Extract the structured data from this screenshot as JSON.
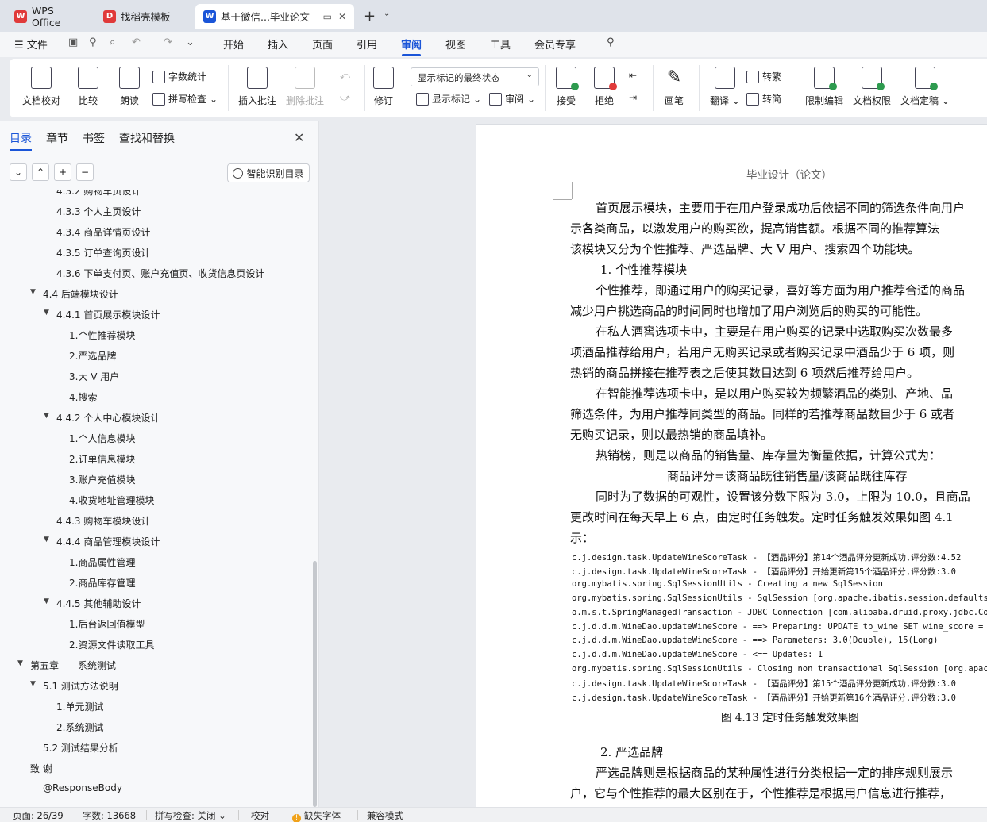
{
  "tabs": [
    {
      "label": "WPS Office",
      "logo": "wps-logo",
      "color": "#e03a3a"
    },
    {
      "label": "找稻壳模板",
      "logo": "daoke-logo",
      "color": "#e03a3a"
    },
    {
      "label": "基于微信...毕业论文",
      "logo": "writer-logo",
      "color": "#1a55d8"
    }
  ],
  "menu": {
    "file": "文件",
    "items": [
      "开始",
      "插入",
      "页面",
      "引用",
      "审阅",
      "视图",
      "工具",
      "会员专享"
    ],
    "active": "审阅"
  },
  "ribbon": {
    "proofread": "文档校对",
    "compare": "比较",
    "read_aloud": "朗读",
    "word_count": "字数统计",
    "spell_check": "拼写检查",
    "insert_comment": "插入批注",
    "delete_comment": "删除批注",
    "track_changes": "修订",
    "markup_state": "显示标记的最终状态",
    "show_markup": "显示标记",
    "review": "审阅",
    "accept": "接受",
    "reject": "拒绝",
    "pen": "画笔",
    "translate": "翻译",
    "to_traditional": "转繁",
    "to_simplified": "转简",
    "restrict_edit": "限制编辑",
    "doc_permission": "文档权限",
    "finalize": "文档定稿"
  },
  "nav": {
    "tabs": [
      "目录",
      "章节",
      "书签",
      "查找和替换"
    ],
    "active_tab": "目录",
    "smart_toc": "智能识别目录",
    "toc": [
      {
        "label": "4.3.2 购物车页设计",
        "level": 3
      },
      {
        "label": "4.3.3 个人主页设计",
        "level": 3
      },
      {
        "label": "4.3.4 商品详情页设计",
        "level": 3
      },
      {
        "label": "4.3.5 订单查询页设计",
        "level": 3
      },
      {
        "label": "4.3.6 下单支付页、账户充值页、收货信息页设计",
        "level": 3
      },
      {
        "label": "4.4 后端模块设计",
        "level": 2,
        "expanded": true
      },
      {
        "label": "4.4.1 首页展示模块设计",
        "level": 3,
        "expanded": true
      },
      {
        "label": "1.个性推荐模块",
        "level": 4
      },
      {
        "label": "2.严选品牌",
        "level": 4
      },
      {
        "label": "3.大 V 用户",
        "level": 4
      },
      {
        "label": "4.搜索",
        "level": 4
      },
      {
        "label": "4.4.2 个人中心模块设计",
        "level": 3,
        "expanded": true
      },
      {
        "label": "1.个人信息模块",
        "level": 4
      },
      {
        "label": "2.订单信息模块",
        "level": 4
      },
      {
        "label": "3.账户充值模块",
        "level": 4
      },
      {
        "label": "4.收货地址管理模块",
        "level": 4
      },
      {
        "label": "4.4.3 购物车模块设计",
        "level": 3
      },
      {
        "label": "4.4.4 商品管理模块设计",
        "level": 3,
        "expanded": true
      },
      {
        "label": "1.商品属性管理",
        "level": 4
      },
      {
        "label": "2.商品库存管理",
        "level": 4
      },
      {
        "label": "4.4.5 其他辅助设计",
        "level": 3,
        "expanded": true
      },
      {
        "label": "1.后台返回值模型",
        "level": 4
      },
      {
        "label": "2.资源文件读取工具",
        "level": 4
      },
      {
        "label": "第五章　　系统测试",
        "level": 1,
        "expanded": true
      },
      {
        "label": "5.1 测试方法说明",
        "level": 2,
        "expanded": true
      },
      {
        "label": "1.单元测试",
        "level": 3
      },
      {
        "label": "2.系统测试",
        "level": 3
      },
      {
        "label": "5.2 测试结果分析",
        "level": 2
      },
      {
        "label": "致 谢",
        "level": 1
      },
      {
        "label": "@ResponseBody",
        "level": 2
      }
    ]
  },
  "doc": {
    "header": "毕业设计（论文）",
    "lines": [
      "首页展示模块，主要用于在用户登录成功后依据不同的筛选条件向用户",
      "示各类商品，以激发用户的购买欲，提高销售额。根据不同的推荐算法",
      "该模块又分为个性推荐、严选品牌、大 V 用户、搜索四个功能块。",
      "1.  个性推荐模块",
      "个性推荐，即通过用户的购买记录，喜好等方面为用户推荐合适的商品",
      "减少用户挑选商品的时间同时也增加了用户浏览后的购买的可能性。",
      "在私人酒窖选项卡中，主要是在用户购买的记录中选取购买次数最多",
      "项酒品推荐给用户，若用户无购买记录或者购买记录中酒品少于 6 项，则",
      "热销的商品拼接在推荐表之后使其数目达到 6 项然后推荐给用户。",
      "在智能推荐选项卡中，是以用户购买较为频繁酒品的类别、产地、品",
      "筛选条件，为用户推荐同类型的商品。同样的若推荐商品数目少于 6 或者",
      "无购买记录，则以最热销的商品填补。",
      "热销榜，则是以商品的销售量、库存量为衡量依据，计算公式为：",
      "商品评分=该商品既往销售量/该商品既往库存",
      "同时为了数据的可观性，设置该分数下限为 3.0，上限为 10.0，且商品",
      "更改时间在每天早上 6 点，由定时任务触发。定时任务触发效果如图 4.1",
      "示："
    ],
    "code": [
      "c.j.design.task.UpdateWineScoreTask - 【酒品评分】第14个酒品评分更新成功,评分数:4.52",
      "c.j.design.task.UpdateWineScoreTask - 【酒品评分】开始更新第15个酒品评分,评分数:3.0",
      "org.mybatis.spring.SqlSessionUtils - Creating a new SqlSession",
      "org.mybatis.spring.SqlSessionUtils - SqlSession [org.apache.ibatis.session.defaults.D",
      "o.m.s.t.SpringManagedTransaction - JDBC Connection [com.alibaba.druid.proxy.jdbc.Conn",
      "c.j.d.d.m.WineDao.updateWineScore - ==>  Preparing: UPDATE tb_wine SET wine_score = ?",
      "c.j.d.d.m.WineDao.updateWineScore - ==> Parameters: 3.0(Double), 15(Long)",
      "c.j.d.d.m.WineDao.updateWineScore - <==    Updates: 1",
      "org.mybatis.spring.SqlSessionUtils - Closing non transactional SqlSession [org.apache",
      "c.j.design.task.UpdateWineScoreTask - 【酒品评分】第15个酒品评分更新成功,评分数:3.0",
      "c.j.design.task.UpdateWineScoreTask - 【酒品评分】开始更新第16个酒品评分,评分数:3.0"
    ],
    "caption": "图 4.13 定时任务触发效果图",
    "lines2": [
      "2.  严选品牌",
      "严选品牌则是根据商品的某种属性进行分类根据一定的排序规则展示",
      "户，它与个性推荐的最大区别在于，个性推荐是根据用户信息进行推荐，"
    ]
  },
  "status": {
    "page": "页面: 26/39",
    "words": "字数: 13668",
    "spell": "拼写检查: 关闭",
    "proof": "校对",
    "missing_font": "缺失字体",
    "compat": "兼容模式"
  }
}
